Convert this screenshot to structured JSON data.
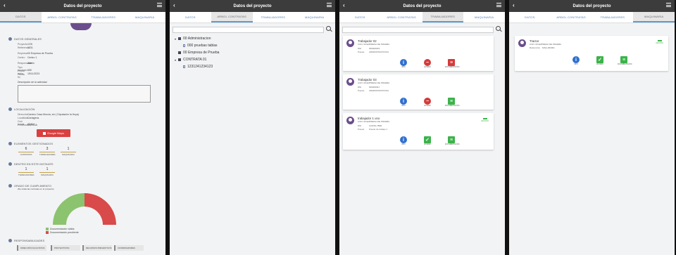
{
  "title": "Datos del proyecto",
  "tabs": [
    "DATOS",
    "ARBOL CONTRATAS",
    "TRABAJADORES",
    "MAQUINARIA"
  ],
  "datos": {
    "general_title": "DATOS GENERALES",
    "general": [
      {
        "k": "Proyecto",
        "v": "1CB"
      },
      {
        "k": "Referencia",
        "v": "1231"
      },
      {
        "k": "Empresa",
        "v": "00 Empresa de Prueba"
      },
      {
        "k": "Centro",
        "v": "Centro 1"
      },
      {
        "k": "Responsable",
        "v": "Admin"
      },
      {
        "k": "Tipo proyecto",
        "v": "650"
      },
      {
        "k": "Fecha inicio",
        "v": "15/11/2023"
      },
      {
        "k": "Fecha fin",
        "v": ""
      }
    ],
    "descripcion_label": "Descripción de la actividad",
    "localizacion_title": "LOCALIZACIÓN",
    "localizacion": [
      {
        "k": "Dirección",
        "v": "Camino Casa Murcia, s/n ( Diputación la Hoya)"
      },
      {
        "k": "Localidad",
        "v": "Cartagena"
      },
      {
        "k": "Cód. postal",
        "v": "30414"
      },
      {
        "k": "Provincia",
        "v": "MURCIA"
      }
    ],
    "google_maps": "Google Maps",
    "elementos_title": "ELEMENTOS GESTIONADOS",
    "elementos": [
      {
        "n": "6",
        "l": "CONTRATAS"
      },
      {
        "n": "3",
        "l": "TRABAJADORES"
      },
      {
        "n": "1",
        "l": "MAQUINARIA"
      }
    ],
    "dentro_title": "DENTRO EN ESTE INSTANTE",
    "dentro": [
      {
        "n": "1",
        "l": "TRABAJADORES"
      },
      {
        "n": "1",
        "l": "MAQUINARIA"
      }
    ],
    "cumplimiento_title": "GRADO DE CUMPLIMIENTO",
    "cumplimiento_sub": "(De todas las contratas en el proyecto)",
    "cumplimiento_chart": {
      "valida_pct": 50,
      "pendiente_pct": 50,
      "valida_color": "#8cc36e",
      "pendiente_color": "#d94a4a"
    },
    "legend_valida": "Documentación válida",
    "legend_pendiente": "Documentación pendiente",
    "responsabilidades_title": "RESPONSABILIDADES",
    "responsabilidades": [
      "DIRECCIÓN FACULTATIVA",
      "PROYECTISTAS",
      "RECURSOS PREVENTIVOS",
      "COORDINADORES"
    ]
  },
  "arbol": [
    {
      "label": "00 Administracion",
      "type": "parent"
    },
    {
      "label": "000 pruebas tablas",
      "type": "child"
    },
    {
      "label": "00 Empresa de Prueba",
      "type": "root"
    },
    {
      "label": "CONTRATA 01",
      "type": "parent"
    },
    {
      "label": "1231241234123",
      "type": "child"
    }
  ],
  "trabajadores": [
    {
      "name": "Trabajador 02",
      "company": "CON: 00 EMPRESA DE PRUEBA",
      "dni_label": "DNI",
      "dni": "00000002S",
      "puesto_label": "Puesto",
      "puesto": "ADMINISTRATIVO/A",
      "badge": "",
      "doc_ok": false
    },
    {
      "name": "Trabajador 03",
      "company": "CON: 00 EMPRESA DE PRUEBA",
      "dni_label": "DNI",
      "dni": "00000003J",
      "puesto_label": "Puesto",
      "puesto": "ADMINISTRATIVO/A",
      "badge": "",
      "doc_ok": true
    },
    {
      "name": "trabajador 1 uno",
      "company": "CON: 00 EMPRESA DE PRUEBA",
      "dni_label": "DNI",
      "dni": "11223S-789R",
      "puesto_label": "Puesto",
      "puesto": "Puesto de trabajo 1",
      "badge": "DENTRO",
      "doc_ok": true
    }
  ],
  "maquinaria": [
    {
      "name": "Tractor",
      "company": "CON: 00 EMPRESA DE PRUEBA",
      "ref_label": "Referencia",
      "ref": "MAQ-000001",
      "badge": "DENTRO"
    }
  ],
  "actions": {
    "info": "INFO",
    "acceso": "ACCESO",
    "documentacion": "DOCUMENTACIÓN"
  },
  "colors": {
    "appbar": "#3c3c3c",
    "tab_accent": "#5b9bd5",
    "info": "#2f6fd1",
    "danger": "#d63a3a",
    "success": "#3bb34a"
  }
}
